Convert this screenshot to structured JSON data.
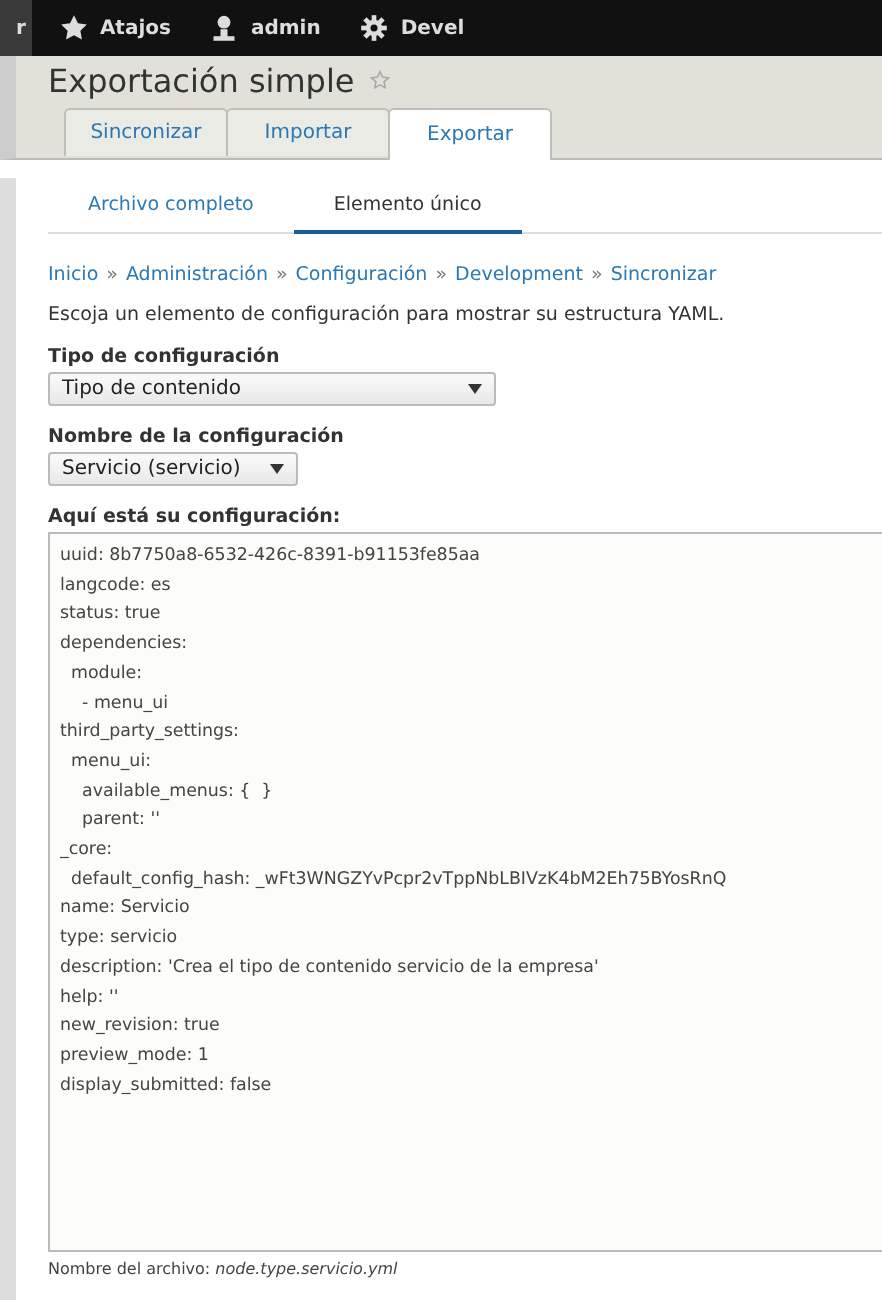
{
  "toolbar": {
    "items": [
      {
        "kind": "cut",
        "label": "r"
      },
      {
        "kind": "star",
        "label": "Atajos"
      },
      {
        "kind": "user",
        "label": "admin"
      },
      {
        "kind": "gear",
        "label": "Devel"
      }
    ]
  },
  "page_title": "Exportación simple",
  "tabs": [
    {
      "label": "Sincronizar",
      "selected": false
    },
    {
      "label": "Importar",
      "selected": false
    },
    {
      "label": "Exportar",
      "selected": true
    }
  ],
  "subtabs": [
    {
      "label": "Archivo completo",
      "selected": false
    },
    {
      "label": "Elemento único",
      "selected": true
    }
  ],
  "breadcrumb": [
    "Inicio",
    "Administración",
    "Configuración",
    "Development",
    "Sincronizar"
  ],
  "breadcrumb_separator": "»",
  "description": "Escoja un elemento de configuración para mostrar su estructura YAML.",
  "fields": [
    {
      "label": "Tipo de configuración",
      "value": "Tipo de contenido"
    },
    {
      "label": "Nombre de la configuración",
      "value": "Servicio (servicio)"
    }
  ],
  "config": {
    "label": "Aquí está su configuración:",
    "lines": [
      "uuid: 8b7750a8-6532-426c-8391-b91153fe85aa",
      "langcode: es",
      "status: true",
      "dependencies:",
      "  module:",
      "    - menu_ui",
      "third_party_settings:",
      "  menu_ui:",
      "    available_menus: {  }",
      "    parent: ''",
      "_core:",
      "  default_config_hash: _wFt3WNGZYvPcpr2vTppNbLBIVzK4bM2Eh75BYosRnQ",
      "name: Servicio",
      "type: servicio",
      "description: 'Crea el tipo de contenido servicio de la empresa'",
      "help: ''",
      "new_revision: true",
      "preview_mode: 1",
      "display_submitted: false"
    ]
  },
  "filename_note": "Nombre del archivo: *node.type.servicio.yml*"
}
